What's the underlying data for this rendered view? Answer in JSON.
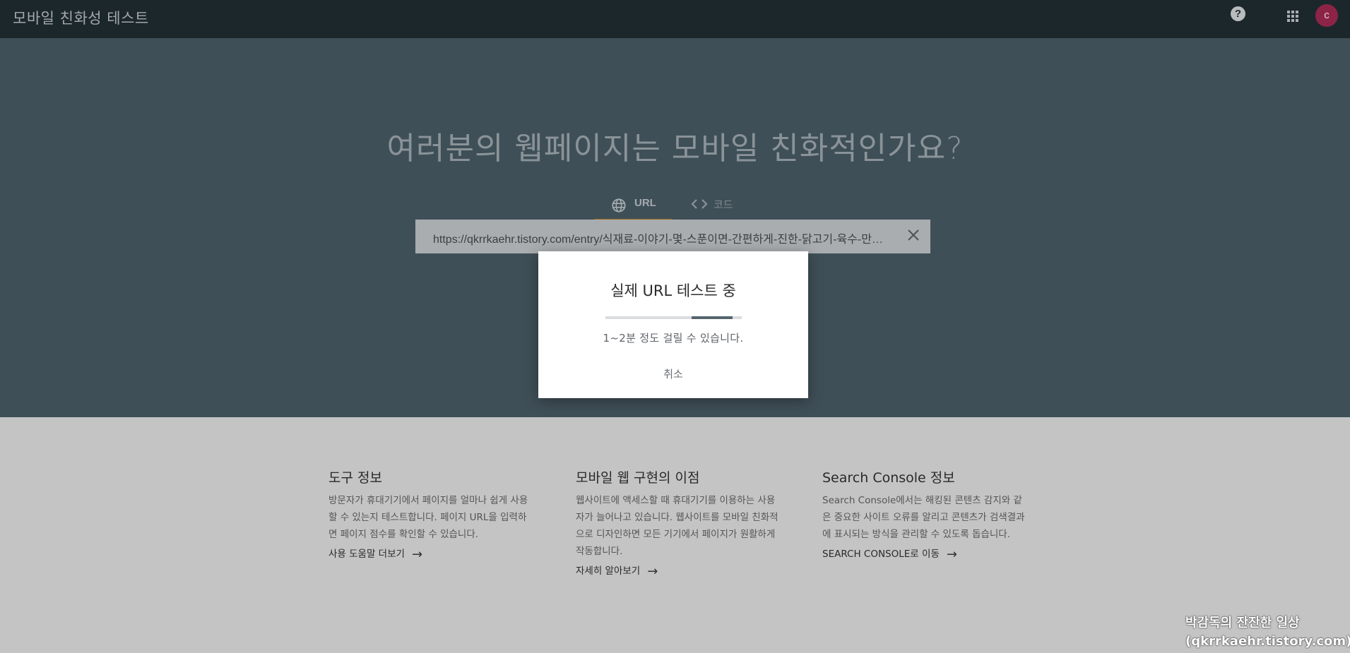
{
  "header": {
    "app_title": "모바일 친화성 테스트",
    "help_icon": "?",
    "apps_icon": "apps-grid-icon",
    "avatar_letter": "c"
  },
  "hero": {
    "title": "여러분의 웹페이지는 모바일 친화적인가요?",
    "tabs": [
      {
        "label": "URL",
        "icon": "globe-icon",
        "active": true
      },
      {
        "label": "코드",
        "icon": "code-icon",
        "active": false
      }
    ],
    "url_input": {
      "value": "https://qkrrkaehr.tistory.com/entry/식재료-이야기-몇-스푼이면-간편하게-진한-닭고기-육수-만들기"
    }
  },
  "dialog": {
    "title": "실제 URL 테스트 중",
    "progress": 0.3,
    "message": "1~2분 정도 걸릴 수 있습니다.",
    "cancel_label": "취소"
  },
  "info": [
    {
      "title": "도구 정보",
      "body": "방문자가 휴대기기에서 페이지를 얼마나 쉽게 사용할 수 있는지 테스트합니다. 페이지 URL을 입력하면 페이지 점수를 확인할 수 있습니다.",
      "link": "사용 도움말 더보기"
    },
    {
      "title": "모바일 웹 구현의 이점",
      "body": "웹사이트에 액세스할 때 휴대기기를 이용하는 사용자가 늘어나고 있습니다. 웹사이트를 모바일 친화적으로 디자인하면 모든 기기에서 페이지가 원활하게 작동합니다.",
      "link": "자세히 알아보기"
    },
    {
      "title": "Search Console 정보",
      "body": "Search Console에서는 해킹된 콘텐츠 감지와 같은 중요한 사이트 오류를 알리고 콘텐츠가 검색결과에 표시되는 방식을 관리할 수 있도록 돕습니다.",
      "link": "SEARCH CONSOLE로 이동"
    }
  ],
  "watermark": {
    "line1": "박감독의 잔잔한 일상",
    "line2": "(qkrrkaehr.tistory.com)"
  },
  "colors": {
    "topbar": "#1c272c",
    "hero": "#3f4f57",
    "tab_indicator": "#9a6b1b",
    "avatar": "#8c2447"
  }
}
